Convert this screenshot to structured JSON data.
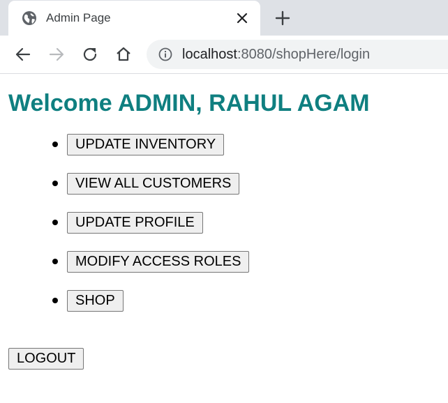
{
  "browser": {
    "tab": {
      "title": "Admin Page",
      "favicon": "globe-icon"
    },
    "new_tab_icon": "plus-icon",
    "toolbar": {
      "back_icon": "back-arrow-icon",
      "forward_icon": "forward-arrow-icon",
      "reload_icon": "reload-icon",
      "home_icon": "home-icon"
    },
    "address": {
      "info_icon": "info-icon",
      "host": "localhost",
      "rest": ":8080/shopHere/login"
    }
  },
  "page": {
    "heading": "Welcome ADMIN, RAHUL AGAM",
    "heading_color": "#0f7f80",
    "menu": [
      {
        "label": "UPDATE INVENTORY"
      },
      {
        "label": "VIEW ALL CUSTOMERS"
      },
      {
        "label": "UPDATE PROFILE"
      },
      {
        "label": "MODIFY ACCESS ROLES"
      },
      {
        "label": "SHOP"
      }
    ],
    "logout_label": "LOGOUT"
  }
}
